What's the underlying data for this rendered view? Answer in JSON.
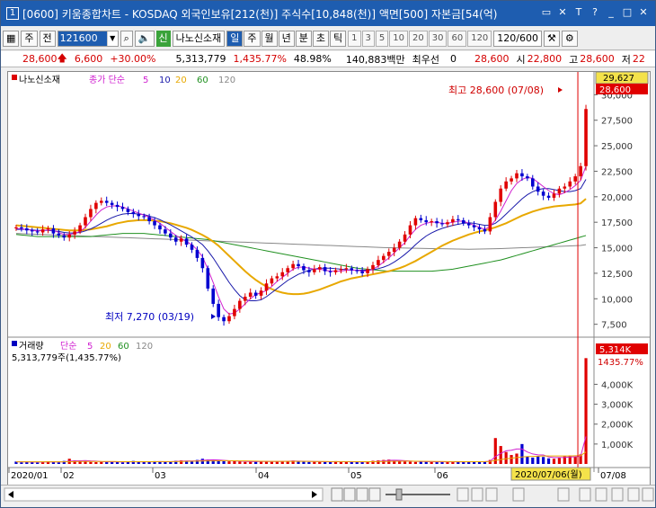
{
  "window": {
    "number": "1",
    "title": "[0600] 키움종합차트 - KOSDAQ 외국인보유[212(천)] 주식수[10,848(천)] 액면[500] 자본금[54(억)",
    "controls": [
      "▭",
      "✕",
      "T",
      "?",
      "_",
      "□",
      "✕"
    ]
  },
  "toolbar": {
    "col1": "주",
    "col2": "전",
    "code": "121600",
    "tag": "신",
    "stock_name": "나노신소재",
    "periods": [
      "일",
      "주",
      "월",
      "년",
      "분",
      "초",
      "틱"
    ],
    "active_period": "일",
    "minutes": [
      "1",
      "3",
      "5",
      "10",
      "20",
      "30",
      "60",
      "120"
    ],
    "count": "120/600"
  },
  "quote": {
    "price": "28,600",
    "change": "6,600",
    "change_pct": "+30.00%",
    "volume": "5,313,779",
    "volume_pct": "1,435.77%",
    "rate": "48.98%",
    "amount": "140,883백만",
    "label_best": "최우선",
    "best_value": "0",
    "best_price": "28,600",
    "open_label": "시",
    "open": "22,800",
    "high_label": "고",
    "high": "28,600",
    "low_label": "저",
    "low": "22"
  },
  "price_panel": {
    "legend_name": "나노신소재",
    "legend_ma_label": "종가 단순",
    "ma_periods": [
      "5",
      "10",
      "20",
      "60",
      "120"
    ],
    "ma_colors": [
      "#d020d0",
      "#1a1aaa",
      "#e8a800",
      "#209020",
      "#888888"
    ],
    "current_price_box": "29,627",
    "current_price_box2": "28,600",
    "high_annotation": "최고 28,600 (07/08)",
    "low_annotation": "최저 7,270 (03/19)"
  },
  "volume_panel": {
    "legend_name": "거래량",
    "legend_ma_label": "단순",
    "ma_periods": [
      "5",
      "20",
      "60",
      "120"
    ],
    "ma_colors": [
      "#d020d0",
      "#e8a800",
      "#209020",
      "#888888"
    ],
    "volume_text": "5,313,779주(1,435.77%)",
    "current_volume_box": "5,314K",
    "current_volume_pct": "1435.77%"
  },
  "x_axis": {
    "labels": [
      "2020/01",
      "02",
      "03",
      "04",
      "05",
      "06",
      "07/08"
    ],
    "crosshair_date": "2020/07/06(월)"
  },
  "chart_data": [
    {
      "type": "candlestick",
      "y_ticks": [
        "30,000",
        "27,500",
        "25,000",
        "22,500",
        "20,000",
        "17,500",
        "15,000",
        "12,500",
        "10,000",
        "7,500"
      ],
      "ylim": [
        6500,
        31000
      ],
      "high": 28600,
      "low": 7270,
      "close": [
        17000,
        16900,
        16700,
        16600,
        16500,
        16800,
        16900,
        16400,
        16200,
        16000,
        16300,
        16600,
        17200,
        18000,
        18800,
        19400,
        19600,
        19400,
        19200,
        19000,
        18800,
        18500,
        18300,
        18100,
        18000,
        17600,
        17200,
        16800,
        16400,
        16000,
        15600,
        15900,
        15300,
        14800,
        14000,
        13000,
        11000,
        9500,
        8200,
        7800,
        8300,
        9000,
        9800,
        10200,
        10600,
        10300,
        10800,
        11500,
        12000,
        12200,
        12600,
        13000,
        13400,
        13200,
        12800,
        12600,
        12900,
        13100,
        12700,
        12600,
        12800,
        12900,
        13000,
        12800,
        12700,
        12500,
        12900,
        13300,
        13800,
        14200,
        14600,
        15000,
        15600,
        16300,
        17200,
        17900,
        17700,
        17500,
        17600,
        17400,
        17300,
        17500,
        17800,
        17700,
        17400,
        17200,
        17000,
        16800,
        16600,
        18000,
        19500,
        20800,
        21500,
        21800,
        22300,
        22000,
        21800,
        21000,
        20500,
        20100,
        19900,
        20300,
        20800,
        21000,
        21500,
        22000,
        23000,
        28600
      ],
      "ma5": [
        16900,
        16850,
        16800,
        16700,
        16650,
        16700,
        16750,
        16700,
        16500,
        16300,
        16300,
        16400,
        16600,
        17000,
        17600,
        18200,
        18700,
        19000,
        19100,
        19100,
        19000,
        18800,
        18600,
        18400,
        18200,
        18000,
        17700,
        17400,
        17000,
        16600,
        16200,
        15900,
        15600,
        15300,
        14800,
        14100,
        12900,
        11600,
        10200,
        9000,
        8500,
        8600,
        9000,
        9500,
        10000,
        10400,
        10600,
        10800,
        11200,
        11700,
        12100,
        12500,
        12900,
        13100,
        13100,
        13000,
        12900,
        12900,
        12800,
        12700,
        12700,
        12700,
        12800,
        12800,
        12800,
        12700,
        12700,
        12900,
        13200,
        13600,
        14000,
        14500,
        15000,
        15500,
        16200,
        16800,
        17200,
        17400,
        17500,
        17500,
        17400,
        17400,
        17500,
        17600,
        17600,
        17400,
        17200,
        17000,
        16800,
        17100,
        17700,
        18600,
        19600,
        20600,
        21300,
        21700,
        21900,
        21800,
        21400,
        21000,
        20600,
        20300,
        20200,
        20400,
        20700,
        21100,
        21600,
        23000
      ],
      "ma10": [
        16800,
        16800,
        16800,
        16750,
        16700,
        16700,
        16700,
        16650,
        16600,
        16500,
        16450,
        16450,
        16500,
        16650,
        16850,
        17100,
        17400,
        17700,
        17950,
        18150,
        18300,
        18350,
        18350,
        18300,
        18250,
        18100,
        17950,
        17750,
        17500,
        17250,
        16950,
        16650,
        16350,
        16050,
        15700,
        15300,
        14700,
        14000,
        13200,
        12400,
        11600,
        10900,
        10300,
        9900,
        9800,
        9800,
        9900,
        10200,
        10600,
        11000,
        11400,
        11800,
        12100,
        12400,
        12600,
        12800,
        12900,
        13000,
        13000,
        13000,
        12950,
        12900,
        12850,
        12800,
        12800,
        12800,
        12800,
        12850,
        12950,
        13100,
        13300,
        13600,
        13950,
        14350,
        14800,
        15300,
        15750,
        16150,
        16450,
        16700,
        16900,
        17050,
        17200,
        17300,
        17400,
        17450,
        17400,
        17300,
        17200,
        17200,
        17400,
        17800,
        18300,
        18800,
        19300,
        19800,
        20200,
        20500,
        20700,
        20800,
        20800,
        20700,
        20600,
        20500,
        20500,
        20600,
        20800,
        21700
      ],
      "ma20": [
        17200,
        17150,
        17100,
        17050,
        17000,
        16950,
        16900,
        16850,
        16800,
        16750,
        16700,
        16700,
        16700,
        16750,
        16800,
        16900,
        17000,
        17100,
        17250,
        17400,
        17500,
        17600,
        17650,
        17700,
        17700,
        17700,
        17650,
        17600,
        17500,
        17400,
        17250,
        17100,
        16950,
        16750,
        16500,
        16250,
        15950,
        15600,
        15200,
        14700,
        14200,
        13700,
        13200,
        12700,
        12250,
        11850,
        11500,
        11200,
        10950,
        10750,
        10600,
        10500,
        10450,
        10450,
        10500,
        10600,
        10750,
        10900,
        11100,
        11300,
        11500,
        11700,
        11850,
        12000,
        12100,
        12200,
        12300,
        12400,
        12500,
        12600,
        12700,
        12850,
        13000,
        13200,
        13450,
        13700,
        14000,
        14300,
        14600,
        14900,
        15200,
        15450,
        15700,
        15900,
        16100,
        16300,
        16450,
        16600,
        16700,
        16850,
        17000,
        17200,
        17400,
        17650,
        17900,
        18150,
        18350,
        18550,
        18700,
        18850,
        18950,
        19050,
        19100,
        19150,
        19200,
        19250,
        19350,
        19800
      ],
      "ma60": [
        16300,
        16250,
        16200,
        16150,
        16100,
        16100,
        16100,
        16100,
        16100,
        16100,
        16100,
        16100,
        16100,
        16100,
        16100,
        16150,
        16200,
        16250,
        16300,
        16350,
        16400,
        16400,
        16400,
        16400,
        16400,
        16350,
        16300,
        16250,
        16200,
        16150,
        16100,
        16050,
        16000,
        15950,
        15900,
        15850,
        15800,
        15700,
        15600,
        15500,
        15400,
        15300,
        15200,
        15100,
        15000,
        14900,
        14800,
        14700,
        14600,
        14500,
        14400,
        14300,
        14200,
        14100,
        14000,
        13900,
        13800,
        13700,
        13600,
        13500,
        13400,
        13300,
        13200,
        13100,
        13000,
        12950,
        12900,
        12850,
        12800,
        12750,
        12700,
        12700,
        12700,
        12700,
        12700,
        12700,
        12700,
        12700,
        12700,
        12750,
        12800,
        12850,
        12900,
        13000,
        13100,
        13200,
        13300,
        13400,
        13500,
        13600,
        13700,
        13800,
        13950,
        14100,
        14250,
        14400,
        14550,
        14700,
        14850,
        15000,
        15150,
        15300,
        15450,
        15600,
        15750,
        15900,
        16050,
        16200
      ],
      "ma120": [
        16400,
        16380,
        16360,
        16340,
        16320,
        16300,
        16280,
        16260,
        16240,
        16220,
        16200,
        16180,
        16160,
        16140,
        16120,
        16100,
        16080,
        16060,
        16040,
        16020,
        16000,
        15980,
        15960,
        15940,
        15920,
        15900,
        15880,
        15860,
        15840,
        15820,
        15800,
        15780,
        15760,
        15740,
        15720,
        15700,
        15680,
        15660,
        15640,
        15620,
        15600,
        15580,
        15560,
        15540,
        15520,
        15500,
        15480,
        15460,
        15440,
        15420,
        15400,
        15380,
        15360,
        15340,
        15320,
        15300,
        15280,
        15260,
        15240,
        15220,
        15200,
        15180,
        15160,
        15140,
        15120,
        15100,
        15080,
        15060,
        15040,
        15020,
        15000,
        14990,
        14980,
        14970,
        14960,
        14950,
        14940,
        14930,
        14920,
        14910,
        14900,
        14890,
        14880,
        14870,
        14860,
        14850,
        14860,
        14870,
        14880,
        14890,
        14900,
        14920,
        14940,
        14960,
        14980,
        15000,
        15020,
        15040,
        15060,
        15080,
        15100,
        15120,
        15140,
        15160,
        15180,
        15200,
        15220,
        15300
      ]
    },
    {
      "type": "bar",
      "y_ticks": [
        "4,000K",
        "3,000K",
        "2,000K",
        "1,000K"
      ],
      "ylim": [
        0,
        5600
      ],
      "values_k": [
        120,
        80,
        90,
        100,
        70,
        110,
        130,
        90,
        80,
        150,
        260,
        180,
        140,
        120,
        100,
        90,
        110,
        130,
        100,
        90,
        80,
        120,
        150,
        110,
        90,
        100,
        140,
        120,
        90,
        130,
        160,
        180,
        150,
        120,
        200,
        260,
        220,
        180,
        150,
        140,
        130,
        160,
        120,
        100,
        110,
        120,
        150,
        130,
        110,
        120,
        140,
        150,
        170,
        120,
        110,
        100,
        130,
        120,
        110,
        100,
        140,
        120,
        110,
        100,
        90,
        100,
        130,
        160,
        180,
        200,
        220,
        160,
        140,
        120,
        110,
        100,
        130,
        120,
        110,
        100,
        90,
        110,
        120,
        100,
        110,
        130,
        120,
        100,
        120,
        200,
        1300,
        900,
        600,
        450,
        520,
        1000,
        380,
        320,
        400,
        350,
        280,
        260,
        300,
        380,
        420,
        360,
        480,
        5314
      ],
      "ma5_k": [
        110,
        105,
        100,
        95,
        95,
        95,
        100,
        100,
        100,
        110,
        140,
        150,
        160,
        170,
        150,
        140,
        120,
        110,
        110,
        105,
        100,
        105,
        110,
        115,
        110,
        110,
        115,
        120,
        115,
        115,
        130,
        140,
        150,
        150,
        160,
        180,
        200,
        210,
        200,
        180,
        160,
        150,
        140,
        130,
        120,
        120,
        125,
        130,
        125,
        125,
        130,
        135,
        145,
        140,
        135,
        130,
        125,
        120,
        115,
        110,
        115,
        115,
        115,
        110,
        105,
        100,
        105,
        115,
        130,
        150,
        180,
        185,
        180,
        165,
        145,
        130,
        125,
        120,
        115,
        110,
        105,
        105,
        105,
        105,
        105,
        110,
        115,
        115,
        115,
        135,
        370,
        530,
        660,
        690,
        750,
        750,
        600,
        500,
        460,
        450,
        350,
        320,
        320,
        330,
        350,
        360,
        390,
        1380
      ],
      "ma20_k": [
        105,
        105,
        105,
        105,
        105,
        105,
        105,
        105,
        105,
        110,
        115,
        120,
        125,
        125,
        125,
        125,
        125,
        125,
        125,
        120,
        115,
        115,
        115,
        115,
        115,
        115,
        115,
        118,
        118,
        118,
        120,
        125,
        130,
        135,
        140,
        145,
        150,
        155,
        160,
        165,
        165,
        160,
        155,
        150,
        145,
        140,
        135,
        132,
        130,
        128,
        128,
        128,
        130,
        130,
        130,
        128,
        126,
        124,
        122,
        120,
        120,
        120,
        118,
        116,
        114,
        112,
        112,
        115,
        120,
        125,
        130,
        135,
        138,
        140,
        140,
        138,
        135,
        130,
        128,
        125,
        122,
        120,
        118,
        116,
        115,
        115,
        115,
        115,
        116,
        125,
        180,
        220,
        260,
        290,
        320,
        350,
        370,
        380,
        390,
        400,
        400,
        400,
        400,
        400,
        400,
        410,
        420,
        600
      ]
    }
  ]
}
